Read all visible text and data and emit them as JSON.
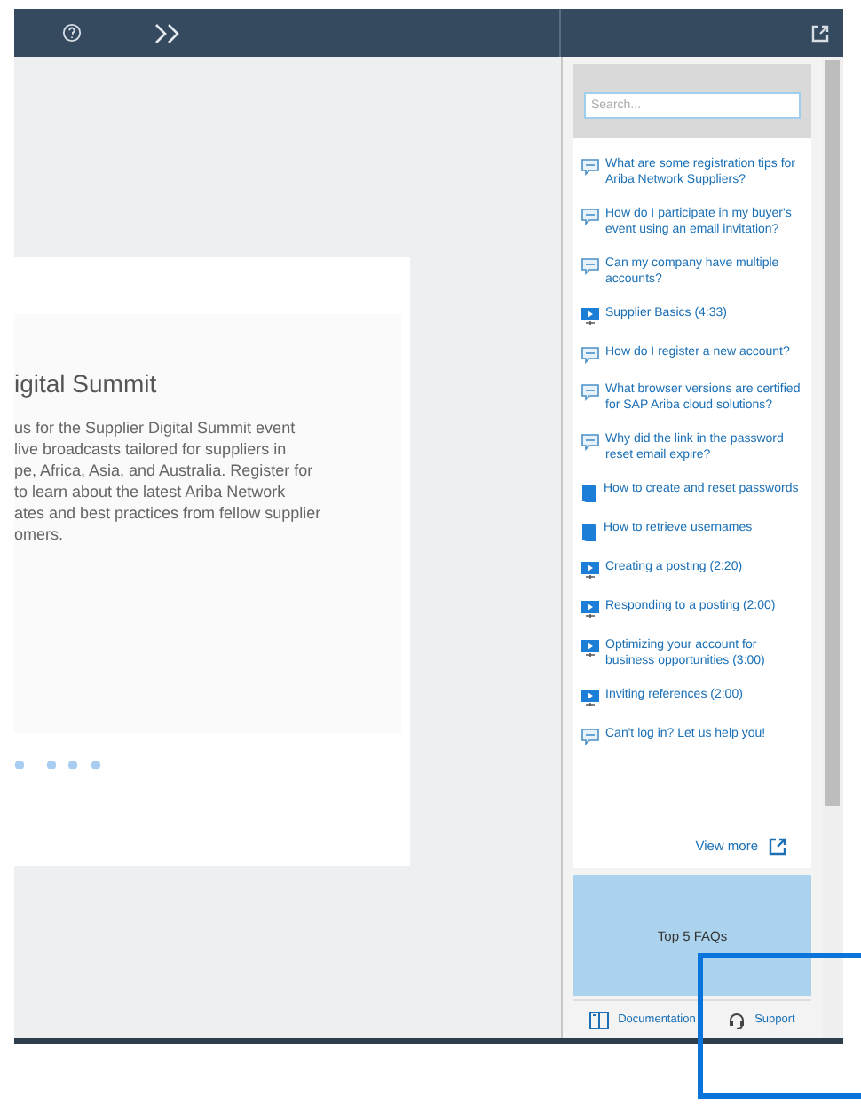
{
  "card": {
    "title": "igital Summit",
    "lines": [
      "us for the Supplier Digital Summit event",
      "live broadcasts tailored for suppliers in",
      "pe, Africa, Asia, and Australia. Register for",
      "to learn about the latest Ariba Network",
      "ates and best practices from fellow supplier",
      "omers."
    ]
  },
  "sidebar": {
    "search": {
      "placeholder": "Search..."
    },
    "items": [
      {
        "kind": "faq",
        "label": "What are some registration tips for Ariba Network Suppliers?"
      },
      {
        "kind": "faq",
        "label": "How do I participate in my buyer's event using an email invitation?"
      },
      {
        "kind": "faq",
        "label": "Can my company have multiple accounts?"
      },
      {
        "kind": "video",
        "label": "Supplier Basics (4:33)"
      },
      {
        "kind": "faq",
        "label": "How do I register a new account?"
      },
      {
        "kind": "faq",
        "label": "What browser versions are certified for SAP Ariba cloud solutions?"
      },
      {
        "kind": "faq",
        "label": "Why did the link in the password reset email expire?"
      },
      {
        "kind": "document",
        "label": "How to create and reset passwords"
      },
      {
        "kind": "document",
        "label": "How to retrieve usernames"
      },
      {
        "kind": "video",
        "label": "Creating a posting (2:20)"
      },
      {
        "kind": "video",
        "label": "Responding to a posting (2:00)"
      },
      {
        "kind": "video",
        "label": "Optimizing your account for business opportunities (3:00)"
      },
      {
        "kind": "video",
        "label": "Inviting references (2:00)"
      },
      {
        "kind": "faq",
        "label": "Can't log in? Let us help you!"
      }
    ],
    "view_more": "View more",
    "top_faqs": "Top 5 FAQs",
    "footer": [
      "Documentation",
      "Support"
    ]
  }
}
